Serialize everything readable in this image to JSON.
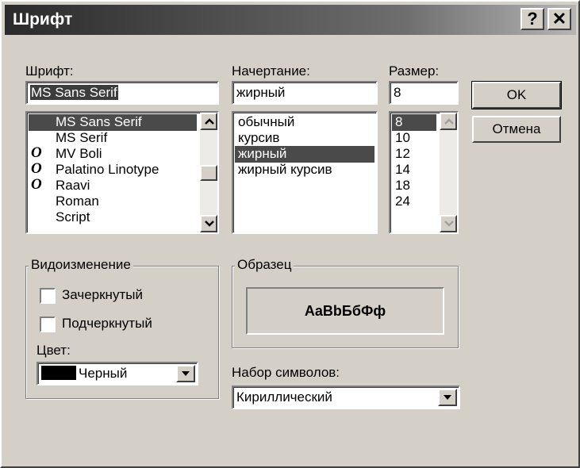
{
  "window": {
    "title": "Шрифт",
    "help_glyph": "?",
    "close_glyph": "✕"
  },
  "font": {
    "label": "Шрифт:",
    "value": "MS Sans Serif",
    "items": [
      {
        "name": "MS Sans Serif",
        "icon": "",
        "selected": true
      },
      {
        "name": "MS Serif",
        "icon": "",
        "selected": false
      },
      {
        "name": "MV Boli",
        "icon": "O",
        "selected": false
      },
      {
        "name": "Palatino Linotype",
        "icon": "O",
        "selected": false
      },
      {
        "name": "Raavi",
        "icon": "O",
        "selected": false
      },
      {
        "name": "Roman",
        "icon": "",
        "selected": false
      },
      {
        "name": "Script",
        "icon": "",
        "selected": false
      }
    ]
  },
  "style": {
    "label": "Начертание:",
    "value": "жирный",
    "items": [
      {
        "name": "обычный",
        "selected": false
      },
      {
        "name": "курсив",
        "selected": false
      },
      {
        "name": "жирный",
        "selected": true
      },
      {
        "name": "жирный курсив",
        "selected": false
      }
    ]
  },
  "size": {
    "label": "Размер:",
    "value": "8",
    "items": [
      {
        "name": "8",
        "selected": true
      },
      {
        "name": "10",
        "selected": false
      },
      {
        "name": "12",
        "selected": false
      },
      {
        "name": "14",
        "selected": false
      },
      {
        "name": "18",
        "selected": false
      },
      {
        "name": "24",
        "selected": false
      }
    ]
  },
  "buttons": {
    "ok": "OK",
    "cancel": "Отмена"
  },
  "effects": {
    "label": "Видоизменение",
    "strikeout": "Зачеркнутый",
    "underline": "Подчеркнутый",
    "color_label": "Цвет:",
    "color_value": "Черный",
    "color_swatch": "#000000"
  },
  "sample": {
    "label": "Образец",
    "text": "AaBbБбФф"
  },
  "charset": {
    "label": "Набор символов:",
    "value": "Кириллический"
  }
}
